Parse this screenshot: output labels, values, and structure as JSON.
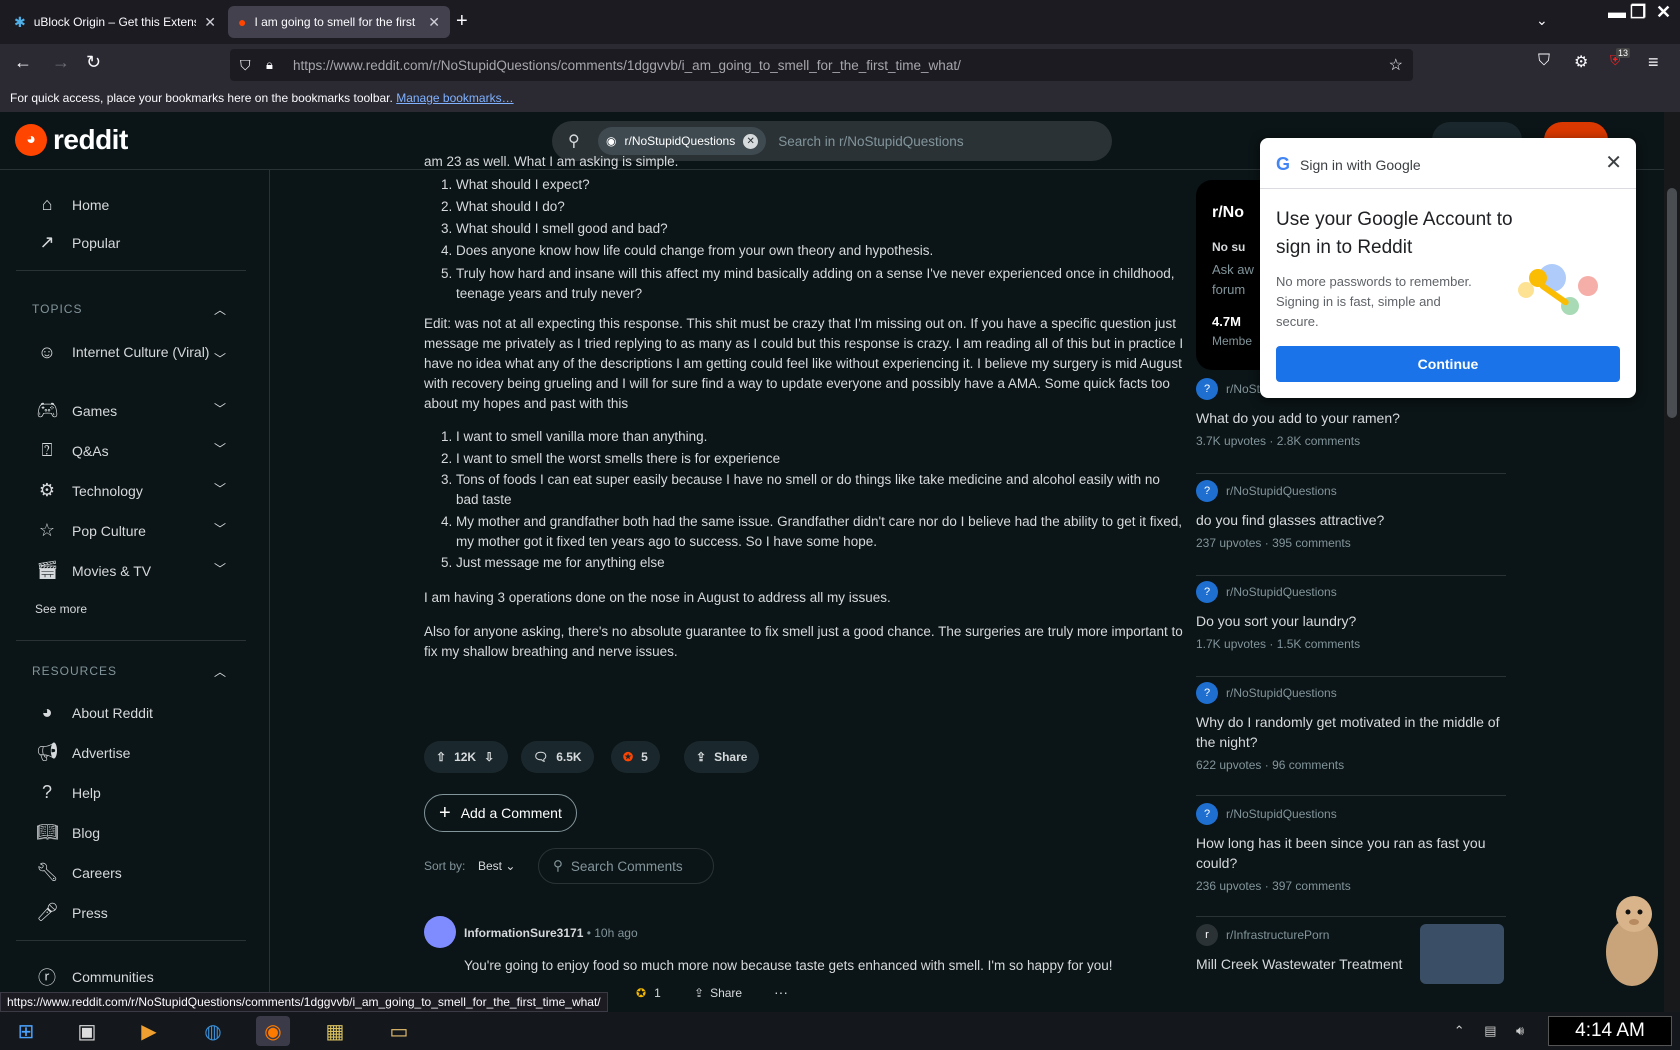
{
  "browser": {
    "tabs": [
      {
        "title": "uBlock Origin – Get this Extensi",
        "active": false
      },
      {
        "title": "I am going to smell for the first",
        "active": true
      }
    ],
    "url": "https://www.reddit.com/r/NoStupidQuestions/comments/1dggvvb/i_am_going_to_smell_for_the_first_time_what/",
    "extension_badge": "13",
    "bookmarks_text": "For quick access, place your bookmarks here on the bookmarks toolbar.",
    "bookmarks_link": "Manage bookmarks…",
    "status_url": "https://www.reddit.com/r/NoStupidQuestions/comments/1dggvvb/i_am_going_to_smell_for_the_first_time_what/"
  },
  "header": {
    "logo": "reddit",
    "search_chip": "r/NoStupidQuestions",
    "search_placeholder": "Search in r/NoStupidQuestions"
  },
  "sidebar": {
    "home": "Home",
    "popular": "Popular",
    "topics_heading": "TOPICS",
    "topics": [
      "Internet Culture (Viral)",
      "Games",
      "Q&As",
      "Technology",
      "Pop Culture",
      "Movies & TV"
    ],
    "see_more": "See more",
    "resources_heading": "RESOURCES",
    "resources": [
      "About Reddit",
      "Advertise",
      "Help",
      "Blog",
      "Careers",
      "Press"
    ],
    "communities": "Communities"
  },
  "post": {
    "cut_line": "am 23 as well. What I am asking is simple.",
    "list1": [
      "What should I expect?",
      "What should I do?",
      "What should I smell good and bad?",
      "Does anyone know how life could change from your own theory and hypothesis.",
      "Truly how hard and insane will this affect my mind basically adding on a sense I've never experienced once in childhood, teenage years and truly never?"
    ],
    "edit_paragraph": "Edit: was not at all expecting this response. This shit must be crazy that I'm missing out on. If you have a specific question just message me privately as I tried replying to as many as I could but this response is crazy. I am reading all of this but in practice I have no idea what any of the descriptions I am getting could feel like without experiencing it. I believe my surgery is mid August with recovery being grueling and I will for sure find a way to update everyone and possibly have a AMA. Some quick facts too about my hopes and past with this",
    "list2": [
      "I want to smell vanilla more than anything.",
      "I want to smell the worst smells there is for experience",
      "Tons of foods I can eat super easily because I have no smell or do things like take medicine and alcohol easily with no bad taste",
      "My mother and grandfather both had the same issue. Grandfather didn't care nor do I believe had the ability to get it fixed, my mother got it fixed ten years ago to success. So I have some hope.",
      "Just message me for anything else"
    ],
    "para2": "I am having 3 operations done on the nose in August to address all my issues.",
    "para3": "Also for anyone asking, there's no absolute guarantee to fix smell just a good chance. The surgeries are truly more important to fix my shallow breathing and nerve issues.",
    "votes": "12K",
    "comments": "6.5K",
    "awards": "5",
    "share": "Share",
    "add_comment": "Add a Comment",
    "sort_label": "Sort by:",
    "sort_value": "Best",
    "search_comments": "Search Comments"
  },
  "comment": {
    "author": "InformationSure3171",
    "time": "• 10h ago",
    "text": "You're going to enjoy food so much more now because taste gets enhanced with smell. I'm so happy for you!",
    "award_count": "1",
    "share": "Share",
    "more": "···"
  },
  "community_card": {
    "name": "r/No",
    "desc1": "No su",
    "desc2": "Ask aw",
    "desc3": "forum",
    "members": "4.7M",
    "members_label": "Membe"
  },
  "related": [
    {
      "sub": "r/NoStupidQuestions",
      "title": "What do you add to your ramen?",
      "upvotes": "3.7K upvotes",
      "comments": "2.8K comments"
    },
    {
      "sub": "r/NoStupidQuestions",
      "title": "do you find glasses attractive?",
      "upvotes": "237 upvotes",
      "comments": "395 comments"
    },
    {
      "sub": "r/NoStupidQuestions",
      "title": "Do you sort your laundry?",
      "upvotes": "1.7K upvotes",
      "comments": "1.5K comments"
    },
    {
      "sub": "r/NoStupidQuestions",
      "title": "Why do I randomly get motivated in the middle of the night?",
      "upvotes": "622 upvotes",
      "comments": "96 comments"
    },
    {
      "sub": "r/NoStupidQuestions",
      "title": "How long has it been since you ran as fast you could?",
      "upvotes": "236 upvotes",
      "comments": "397 comments"
    },
    {
      "sub": "r/InfrastructurePorn",
      "title": "Mill Creek Wastewater Treatment",
      "upvotes": "",
      "comments": ""
    }
  ],
  "google_popup": {
    "header": "Sign in with Google",
    "title": "Use your Google Account to sign in to Reddit",
    "body": "No more passwords to remember. Signing in is fast, simple and secure.",
    "button": "Continue"
  },
  "taskbar": {
    "clock": "4:14 AM"
  }
}
